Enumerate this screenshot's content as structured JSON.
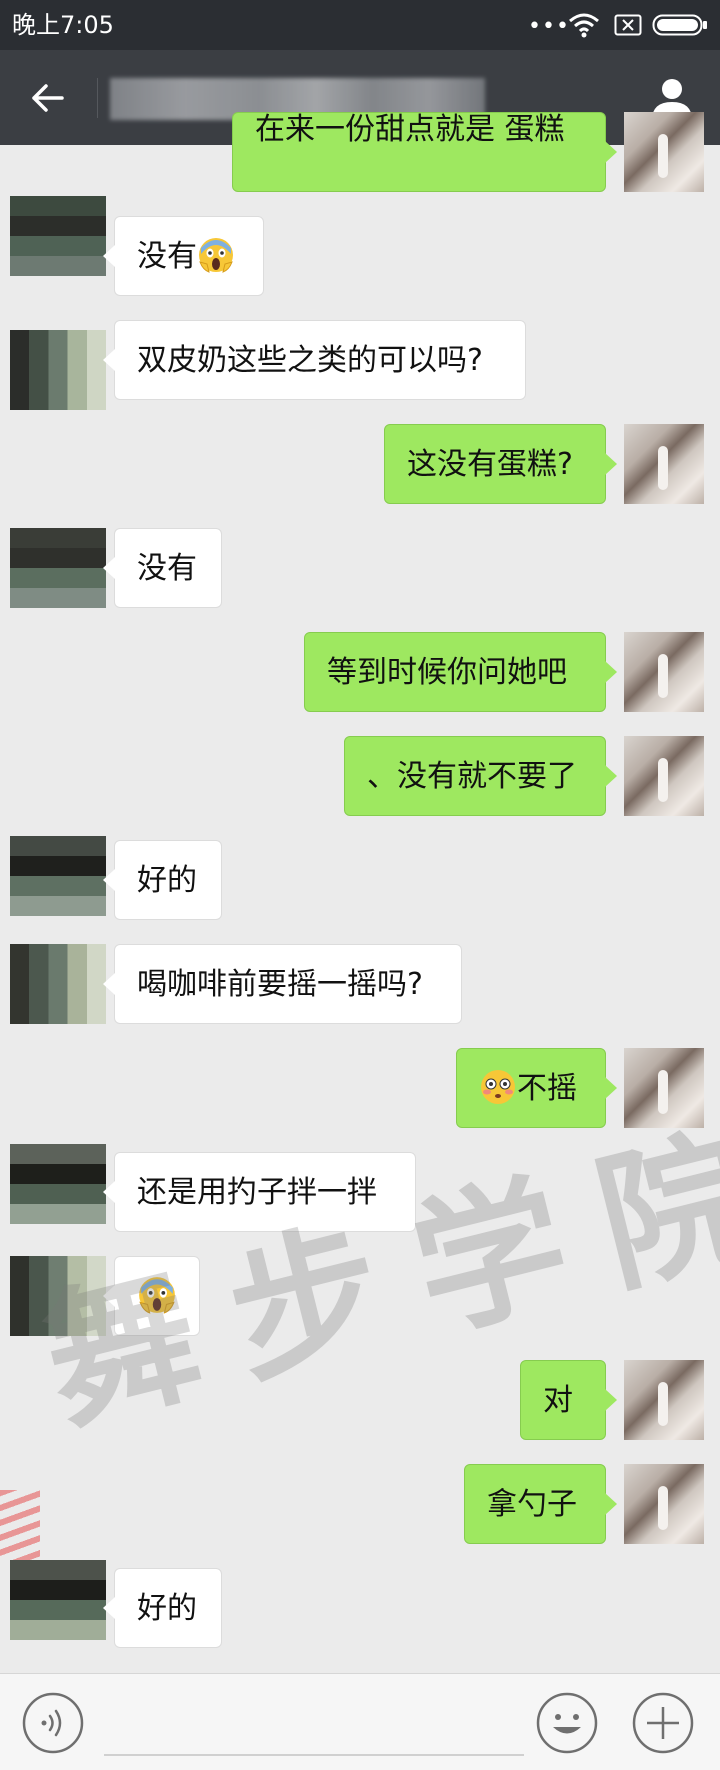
{
  "status_bar": {
    "time": "晚上7:05",
    "more": "•••",
    "icons": [
      "wifi-icon",
      "sim-icon",
      "battery-icon"
    ]
  },
  "header": {
    "back_icon": "back-arrow-icon",
    "profile_icon": "profile-icon",
    "title": ""
  },
  "messages": [
    {
      "side": "right",
      "text": "在来一份甜点就是 蛋糕"
    },
    {
      "side": "left",
      "text": "没有",
      "emoji": "face-screaming-in-fear"
    },
    {
      "side": "left",
      "text": "双皮奶这些之类的可以吗?"
    },
    {
      "side": "right",
      "text": "这没有蛋糕?"
    },
    {
      "side": "left",
      "text": "没有"
    },
    {
      "side": "right",
      "text": "等到时候你问她吧"
    },
    {
      "side": "right",
      "text": "、没有就不要了"
    },
    {
      "side": "left",
      "text": "好的"
    },
    {
      "side": "left",
      "text": "喝咖啡前要摇一摇吗?"
    },
    {
      "side": "right",
      "text": "不摇",
      "emoji": "flushed-face"
    },
    {
      "side": "left",
      "text": "还是用扚子拌一拌"
    },
    {
      "side": "left",
      "text": "",
      "emoji": "face-screaming-in-fear"
    },
    {
      "side": "right",
      "text": "对"
    },
    {
      "side": "right",
      "text": "拿勺子"
    },
    {
      "side": "left",
      "text": "好的"
    }
  ],
  "watermark": "舞步学院",
  "input_bar": {
    "voice_icon": "voice-icon",
    "emoji_icon": "smiley-icon",
    "plus_icon": "plus-icon",
    "value": "",
    "placeholder": ""
  },
  "colors": {
    "status_bar": "#2b2e33",
    "header": "#3b3e43",
    "background": "#ebebeb",
    "bubble_out": "#9ee860",
    "bubble_in": "#ffffff"
  }
}
